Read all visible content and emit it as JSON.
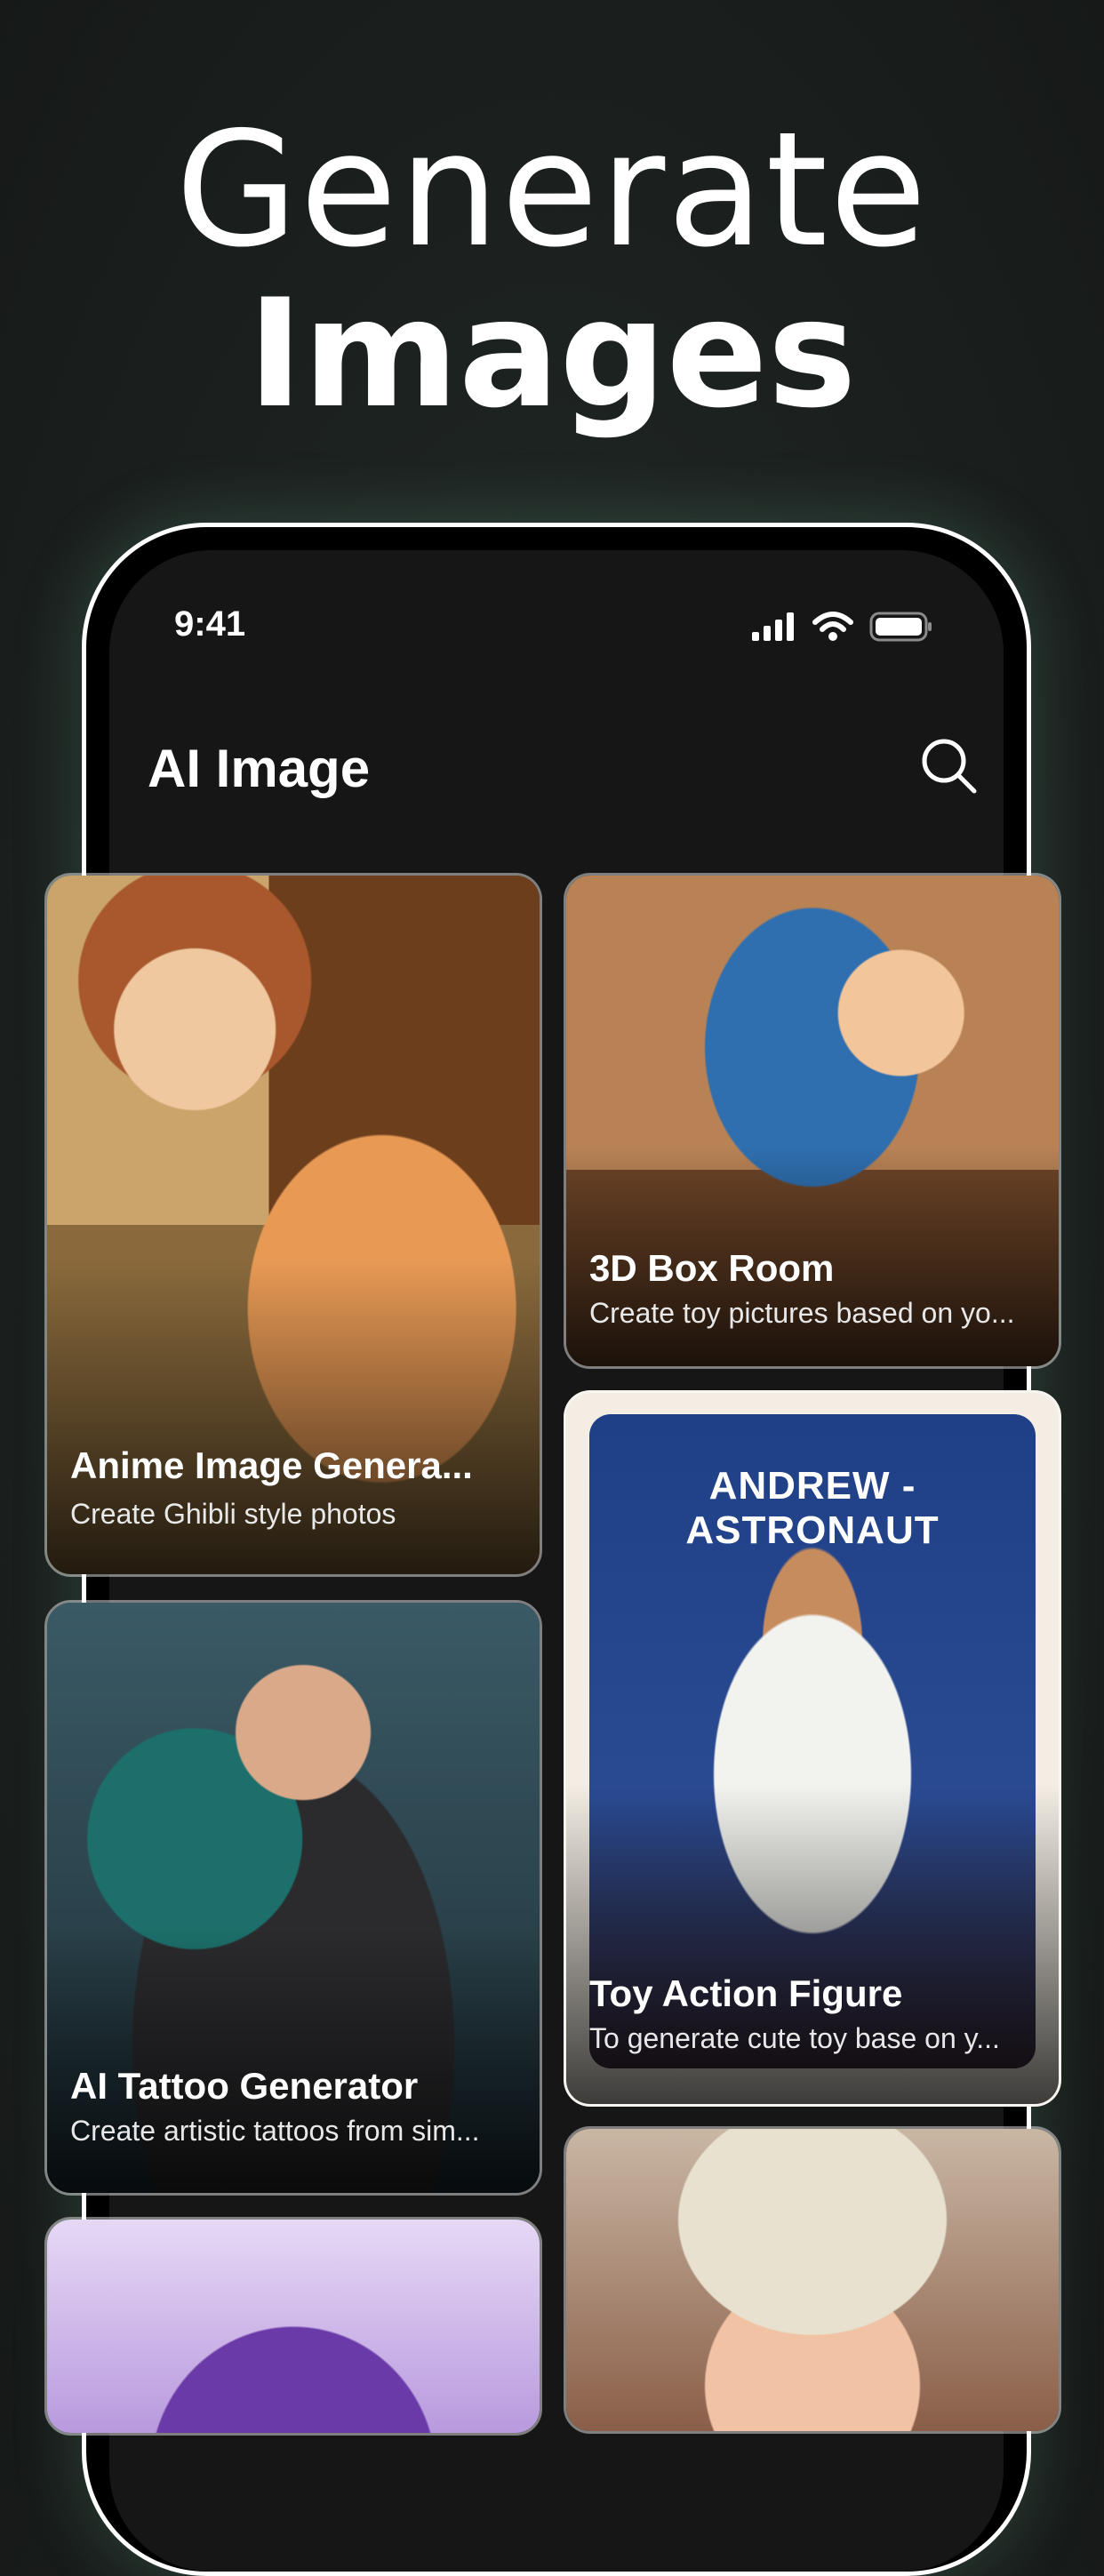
{
  "headline": {
    "line1": "Generate",
    "line2": "Images"
  },
  "status_bar": {
    "time": "9:41"
  },
  "app": {
    "title": "AI Image"
  },
  "cards": [
    {
      "title": "Anime Image Genera...",
      "subtitle": "Create Ghibli style photos"
    },
    {
      "title": "3D Box Room",
      "subtitle": "Create toy pictures based on yo..."
    },
    {
      "title": "Toy Action Figure",
      "subtitle": "To generate cute toy base on y...",
      "package_label": "ANDREW - ASTRONAUT"
    },
    {
      "title": "AI Tattoo Generator",
      "subtitle": "Create artistic tattoos from sim..."
    }
  ],
  "icons": [
    "search-icon",
    "signal-icon",
    "wifi-icon",
    "battery-icon"
  ]
}
